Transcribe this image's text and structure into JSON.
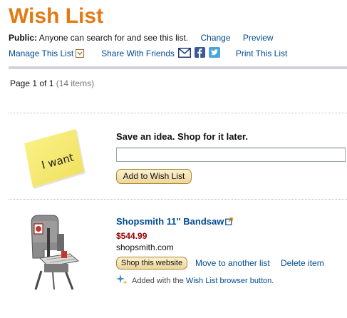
{
  "header": {
    "title": "Wish List",
    "privacy_label": "Public:",
    "privacy_text": "Anyone can search for and see this list.",
    "change_link": "Change",
    "preview_link": "Preview",
    "manage_link": "Manage This List",
    "share_label": "Share With Friends",
    "print_link": "Print This List"
  },
  "pagination": {
    "text": "Page 1 of 1",
    "count": "(14 items)"
  },
  "save_idea": {
    "sticky_text": "I want",
    "heading": "Save an idea. Shop for it later.",
    "input_value": "",
    "add_button": "Add to Wish List"
  },
  "item": {
    "name": "Shopsmith 11\" Bandsaw",
    "price": "$544.99",
    "site": "shopsmith.com",
    "shop_button": "Shop this website",
    "move_link": "Move to another list",
    "delete_link": "Delete item",
    "added_prefix": "Added with the",
    "added_link": "Wish List browser button."
  },
  "colors": {
    "title": "#e47911",
    "link": "#004b91",
    "price": "#990000",
    "facebook": "#3b5998",
    "twitter": "#4ea4dd"
  },
  "icons": [
    "chevron-down-icon",
    "email-icon",
    "facebook-icon",
    "twitter-icon",
    "external-link-icon",
    "sparkle-icon"
  ]
}
